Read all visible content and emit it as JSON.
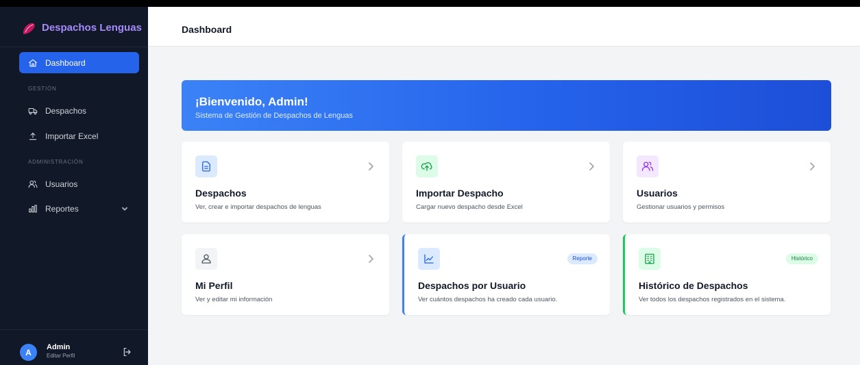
{
  "brand": {
    "name": "Despachos Lenguas"
  },
  "sidebar": {
    "dashboard_label": "Dashboard",
    "section_gestion": "GESTIÓN",
    "despachos_label": "Despachos",
    "importar_label": "Importar Excel",
    "section_admin": "ADMINISTRACIÓN",
    "usuarios_label": "Usuarios",
    "reportes_label": "Reportes"
  },
  "user": {
    "initial": "A",
    "name": "Admin",
    "subtitle": "Editar Perfil"
  },
  "header": {
    "title": "Dashboard"
  },
  "welcome": {
    "title": "¡Bienvenido, Admin!",
    "subtitle": "Sistema de Gestión de Despachos de Lenguas"
  },
  "cards": [
    {
      "title": "Despachos",
      "description": "Ver, crear e importar despachos de lenguas",
      "icon": "document-icon"
    },
    {
      "title": "Importar Despacho",
      "description": "Cargar nuevo despacho desde Excel",
      "icon": "cloud-upload-icon"
    },
    {
      "title": "Usuarios",
      "description": "Gestionar usuarios y permisos",
      "icon": "users-icon"
    },
    {
      "title": "Mi Perfil",
      "description": "Ver y editar mi información",
      "icon": "user-icon"
    },
    {
      "title": "Despachos por Usuario",
      "description": "Ver cuántos despachos ha creado cada usuario.",
      "icon": "line-chart-icon",
      "badge": "Reporte"
    },
    {
      "title": "Histórico de Despachos",
      "description": "Ver todos los despachos registrados en el sistema.",
      "icon": "building-icon",
      "badge": "Histórico"
    }
  ],
  "colors": {
    "sidebar_bg": "#111827",
    "accent_blue": "#2563eb",
    "accent_green": "#22c55e",
    "brand_purple": "#a78bfa"
  }
}
